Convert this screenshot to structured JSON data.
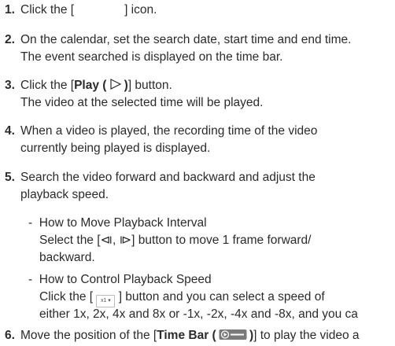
{
  "steps": [
    {
      "num": "1.",
      "text_a": "Click the [",
      "text_b": "] icon."
    },
    {
      "num": "2.",
      "line1": "On the calendar, set the search date, start time and end time.",
      "line2": "The event searched is displayed on the time bar."
    },
    {
      "num": "3.",
      "text_a": "Click the [",
      "bold": "Play (",
      "bold_close": ")",
      "text_b": "] button.",
      "line2": "The video at the selected time will be played."
    },
    {
      "num": "4.",
      "line1": "When a video is played, the recording time of the video",
      "line2": "currently being played is displayed."
    },
    {
      "num": "5.",
      "line1": "Search the video forward and backward and adjust the",
      "line2": "playback speed."
    },
    {
      "num": "6.",
      "text_a": "Move the position of the [",
      "bold": "Time Bar (",
      "bold_close": ")",
      "text_b": "] to play the video a"
    }
  ],
  "sub_items": [
    {
      "dash": "-",
      "title": "How to Move Playback Interval",
      "line1_a": "Select the [",
      "line1_icons": "⧏, ⧐",
      "line1_b": "] button to move 1 frame forward/",
      "line2": "backward."
    },
    {
      "dash": "-",
      "title": "How to Control Playback Speed",
      "line1_a": "Click the [",
      "speed_icon_text": "x1 ▾",
      "line1_b": "] button and you can select a speed of",
      "line2": "either 1x, 2x, 4x and 8x or -1x, -2x, -4x and -8x, and you ca"
    }
  ],
  "icons": {
    "play": "play-triangle-icon",
    "frame_step": "frame-step-icons",
    "speed": "speed-select-icon",
    "timebar": "time-bar-icon",
    "search_icon": "blank-icon"
  }
}
